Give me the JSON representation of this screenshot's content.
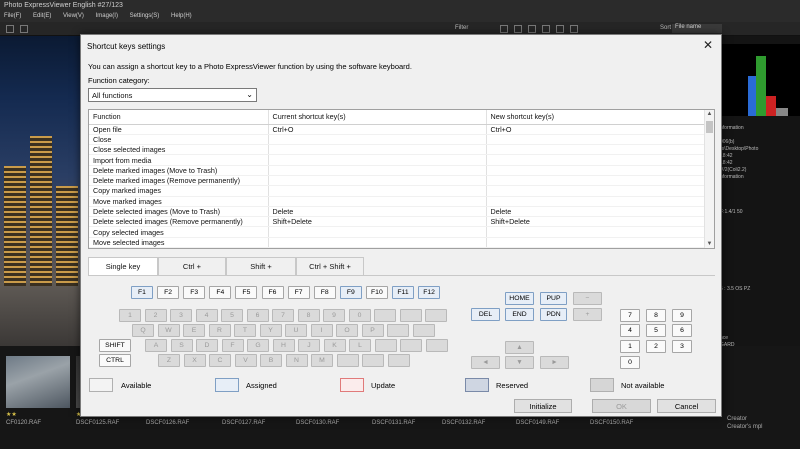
{
  "app": {
    "title": "Photo ExpressViewer English   #27/123",
    "menu": [
      "File(F)",
      "Edit(E)",
      "View(V)",
      "Image(I)",
      "Settings(S)",
      "Help(H)"
    ],
    "toolbar_filter": "Filter",
    "toolbar_sort_label": "Sort",
    "toolbar_sort_value": "File name",
    "info_lines": [
      "nformation",
      "",
      "006(b)",
      "rs\\Desktop\\Photo",
      "18:42",
      "18:42",
      "V/2(Coli2.2)",
      "nformation",
      "",
      "",
      "",
      "",
      "F:1.4/1 50",
      "",
      "",
      "",
      "",
      "",
      "",
      "",
      "",
      "",
      "",
      "5 : 3.5 OS PZ",
      "",
      "",
      "",
      "",
      "",
      "",
      "nce",
      "GARD"
    ],
    "thumbnails": [
      "CF0120.RAF",
      "DSCF0125.RAF",
      "DSCF0126.RAF",
      "DSCF0127.RAF",
      "DSCF0130.RAF",
      "DSCF0131.RAF",
      "DSCF0132.RAF",
      "DSCF0149.RAF",
      "DSCF0150.RAF",
      "Creator",
      "Creator's mpl"
    ],
    "right_labels": [
      "Creator",
      "Creator's mpl"
    ]
  },
  "dialog": {
    "title": "Shortcut keys settings",
    "close_glyph": "✕",
    "description": "You can assign a shortcut key to a Photo ExpressViewer function by using the software keyboard.",
    "category_label": "Function category:",
    "category_value": "All functions",
    "table": {
      "headers": [
        "Function",
        "Current shortcut key(s)",
        "New shortcut key(s)"
      ],
      "rows": [
        [
          "Open file",
          "Ctrl+O",
          "Ctrl+O"
        ],
        [
          "Close",
          "",
          ""
        ],
        [
          "Close selected images",
          "",
          ""
        ],
        [
          "Import from media",
          "",
          ""
        ],
        [
          "Delete marked images (Move to Trash)",
          "",
          ""
        ],
        [
          "Delete marked images (Remove permanently)",
          "",
          ""
        ],
        [
          "Copy marked images",
          "",
          ""
        ],
        [
          "Move marked images",
          "",
          ""
        ],
        [
          "Delete selected images (Move to Trash)",
          "Delete",
          "Delete"
        ],
        [
          "Delete selected images (Remove permanently)",
          "Shift+Delete",
          "Shift+Delete"
        ],
        [
          "Copy selected images",
          "",
          ""
        ],
        [
          "Move selected images",
          "",
          ""
        ]
      ]
    },
    "tabs": [
      "Single key",
      "Ctrl +",
      "Shift +",
      "Ctrl + Shift +"
    ],
    "active_tab": "Single key",
    "fkeys": [
      "F1",
      "F2",
      "F3",
      "F4",
      "F5",
      "F6",
      "F7",
      "F8",
      "F9",
      "F10",
      "F11",
      "F12"
    ],
    "number_row": [
      "1",
      "2",
      "3",
      "4",
      "5",
      "6",
      "7",
      "8",
      "9",
      "0",
      "",
      "",
      ""
    ],
    "row_q": [
      "Q",
      "W",
      "E",
      "R",
      "T",
      "Y",
      "U",
      "I",
      "O",
      "P",
      "",
      ""
    ],
    "row_a": [
      "A",
      "S",
      "D",
      "F",
      "G",
      "H",
      "J",
      "K",
      "L",
      "",
      "",
      ""
    ],
    "row_z": [
      "Z",
      "X",
      "C",
      "V",
      "B",
      "N",
      "M",
      "",
      "",
      ""
    ],
    "shift": "SHIFT",
    "ctrl": "CTRL",
    "nav": {
      "home": "HOME",
      "pup": "PUP",
      "minus": "−",
      "del": "DEL",
      "end": "END",
      "pdn": "PDN",
      "plus": "+"
    },
    "arrows": {
      "up": "▲",
      "left": "◄",
      "down": "▼",
      "right": "►"
    },
    "numpad": [
      "7",
      "8",
      "9",
      "4",
      "5",
      "6",
      "1",
      "2",
      "3",
      "0"
    ],
    "legend": {
      "available": "Available",
      "assigned": "Assigned",
      "update": "Update",
      "reserved": "Reserved",
      "not_available": "Not available"
    },
    "buttons": {
      "initialize": "Initialize",
      "ok": "OK",
      "cancel": "Cancel"
    }
  }
}
